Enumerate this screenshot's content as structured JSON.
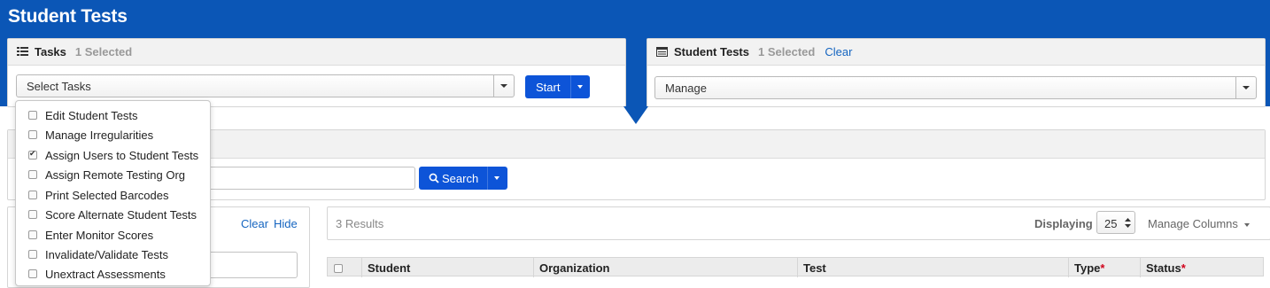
{
  "page": {
    "title": "Student Tests"
  },
  "tasks_panel": {
    "icon": "list-icon",
    "title": "Tasks",
    "selected": "1 Selected",
    "select_value": "Select Tasks",
    "start_label": "Start"
  },
  "tests_panel": {
    "icon": "table-icon",
    "title": "Student Tests",
    "selected": "1 Selected",
    "clear_label": "Clear",
    "manage_value": "Manage"
  },
  "task_menu": {
    "items": [
      {
        "label": "Edit Student Tests",
        "checked": false
      },
      {
        "label": "Manage Irregularities",
        "checked": false
      },
      {
        "label": "Assign Users to Student Tests",
        "checked": true
      },
      {
        "label": "Assign Remote Testing Org",
        "checked": false
      },
      {
        "label": "Print Selected Barcodes",
        "checked": false
      },
      {
        "label": "Score Alternate Student Tests",
        "checked": false
      },
      {
        "label": "Enter Monitor Scores",
        "checked": false
      },
      {
        "label": "Invalidate/Validate Tests",
        "checked": false
      },
      {
        "label": "Unextract Assessments",
        "checked": false
      }
    ]
  },
  "search": {
    "button_label": "Search",
    "input_value": ""
  },
  "filters": {
    "clear_label": "Clear",
    "hide_label": "Hide"
  },
  "results": {
    "count_label": "3 Results",
    "displaying_label": "Displaying",
    "page_size": "25",
    "manage_columns_label": "Manage Columns",
    "columns": [
      "Student",
      "Organization",
      "Test",
      "Type",
      "Status"
    ],
    "required_mark": "*"
  },
  "colors": {
    "brand_blue": "#0b56b6",
    "button_blue": "#0d54d8",
    "link_blue": "#1565c0"
  }
}
